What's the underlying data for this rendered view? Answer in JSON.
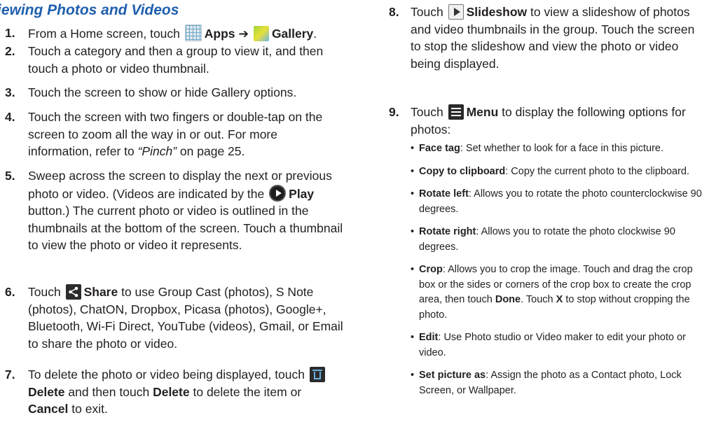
{
  "heading": "iewing Photos and Videos",
  "icons": {
    "apps": "apps-grid-icon",
    "gallery": "gallery-icon",
    "play": "play-icon",
    "share": "share-icon",
    "delete": "trash-icon",
    "slideshow": "slideshow-icon",
    "menu": "menu-icon"
  },
  "steps": [
    {
      "num": "1.",
      "pre": "From a Home screen, touch",
      "b1": "Apps",
      "arrow": "➔",
      "b2": "Gallery",
      "post": "."
    },
    {
      "num": "2.",
      "text": "Touch a category and then a group to view it, and then touch a photo or video thumbnail."
    },
    {
      "num": "3.",
      "text": "Touch the screen to show or hide Gallery options."
    },
    {
      "num": "4.",
      "pre": "Touch the screen with two fingers or double-tap on the screen to zoom all the way in or out. For more information, refer to",
      "ref": "“Pinch”",
      "post": "on page 25."
    },
    {
      "num": "5.",
      "pre": "Sweep across the screen to display the next or previous photo or video. (Videos are indicated by the",
      "b1": "Play",
      "post": "button.) The current photo or video is outlined in the thumbnails at the bottom of the screen. Touch a thumbnail to view the photo or video it represents."
    },
    {
      "num": "6.",
      "pre": "Touch",
      "b1": "Share",
      "post": "to use Group Cast (photos), S Note (photos), ChatON, Dropbox, Picasa (photos), Google+, Bluetooth, Wi-Fi Direct, YouTube (videos), Gmail, or Email to share the photo or video."
    },
    {
      "num": "7.",
      "pre": "To delete the photo or video being displayed, touch",
      "b1": "Delete",
      "mid": "and then touch",
      "b2": "Delete",
      "mid2": "to delete the item or",
      "b3": "Cancel",
      "post": "to exit."
    },
    {
      "num": "8.",
      "pre": "Touch",
      "b1": "Slideshow",
      "post": "to view a slideshow of photos and video thumbnails in the group. Touch the screen to stop the slideshow and view the photo or video being displayed."
    },
    {
      "num": "9.",
      "pre": "Touch",
      "b1": "Menu",
      "post": "to display the following options for photos:"
    }
  ],
  "options": [
    {
      "term": "Face tag",
      "desc": ": Set whether to look for a face in this picture."
    },
    {
      "term": "Copy to clipboard",
      "desc": ": Copy the current photo to the clipboard."
    },
    {
      "term": "Rotate left",
      "desc": ": Allows you to rotate the photo counterclockwise 90 degrees."
    },
    {
      "term": "Rotate right",
      "desc": ": Allows you to rotate the photo clockwise 90 degrees."
    },
    {
      "term": "Crop",
      "desc": ": Allows you to crop the image. Touch and drag the crop box or the sides or corners of the crop box to create the crop area, then touch",
      "b": "Done",
      "desc2": ". Touch",
      "b2": "X",
      "desc3": "to stop without cropping the photo."
    },
    {
      "term": "Edit",
      "desc": ": Use Photo studio or Video maker to edit your photo or video."
    },
    {
      "term": "Set picture as",
      "desc": ": Assign the photo as a Contact photo, Lock Screen, or Wallpaper."
    }
  ]
}
